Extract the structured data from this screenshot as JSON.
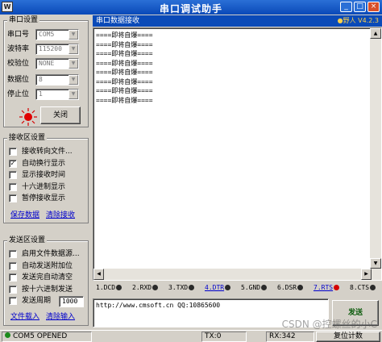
{
  "app": {
    "title": "串口调试助手",
    "logo": "W"
  },
  "port": {
    "group_title": "串口设置",
    "rows": [
      {
        "label": "串口号",
        "value": "COM5"
      },
      {
        "label": "波特率",
        "value": "115200"
      },
      {
        "label": "校验位",
        "value": "NONE"
      },
      {
        "label": "数据位",
        "value": "8"
      },
      {
        "label": "停止位",
        "value": "1"
      }
    ],
    "close_button": "关闭"
  },
  "recv_settings": {
    "group_title": "接收区设置",
    "options": [
      {
        "label": "接收转向文件...",
        "checked": false
      },
      {
        "label": "自动换行显示",
        "checked": true
      },
      {
        "label": "显示接收时间",
        "checked": false
      },
      {
        "label": "十六进制显示",
        "checked": false
      },
      {
        "label": "暂停接收显示",
        "checked": false
      }
    ],
    "save_link": "保存数据",
    "clear_link": "清除接收"
  },
  "send_settings": {
    "group_title": "发送区设置",
    "options": [
      {
        "label": "启用文件数据源...",
        "checked": false
      },
      {
        "label": "自动发送附加位",
        "checked": false
      },
      {
        "label": "发送完自动清空",
        "checked": false
      },
      {
        "label": "按十六进制发送",
        "checked": false
      },
      {
        "label": "发送周期",
        "checked": false
      }
    ],
    "period_value": "1000",
    "load_link": "文件载入",
    "clear_link": "清除输入"
  },
  "recv_area": {
    "header": "串口数据接收",
    "version": "●野人 V4.2.3",
    "lines": [
      "====即将自爆====",
      "====即将自爆====",
      "====即将自爆====",
      "====即将自爆====",
      "====即将自爆====",
      "====即将自爆====",
      "====即将自爆====",
      "====即将自爆===="
    ]
  },
  "signals": [
    "1.DCD",
    "2.RXD",
    "3.TXD",
    "4.DTR",
    "5.GND",
    "6.DSR",
    "7.RTS",
    "8.CTS"
  ],
  "send_area": {
    "text": "http://www.cmsoft.cn QQ:10865600",
    "send_button": "发送"
  },
  "status": {
    "port": "COM5 OPENED",
    "tx": "TX:0",
    "rx": "RX:342",
    "reset": "复位计数"
  },
  "watermark": "CSDN @控螺丝的小C",
  "colors": {
    "title_bar": "#0a49b8",
    "recv_header": "#0a4ab8",
    "link": "#0000cc",
    "led_red": "#d40000"
  }
}
